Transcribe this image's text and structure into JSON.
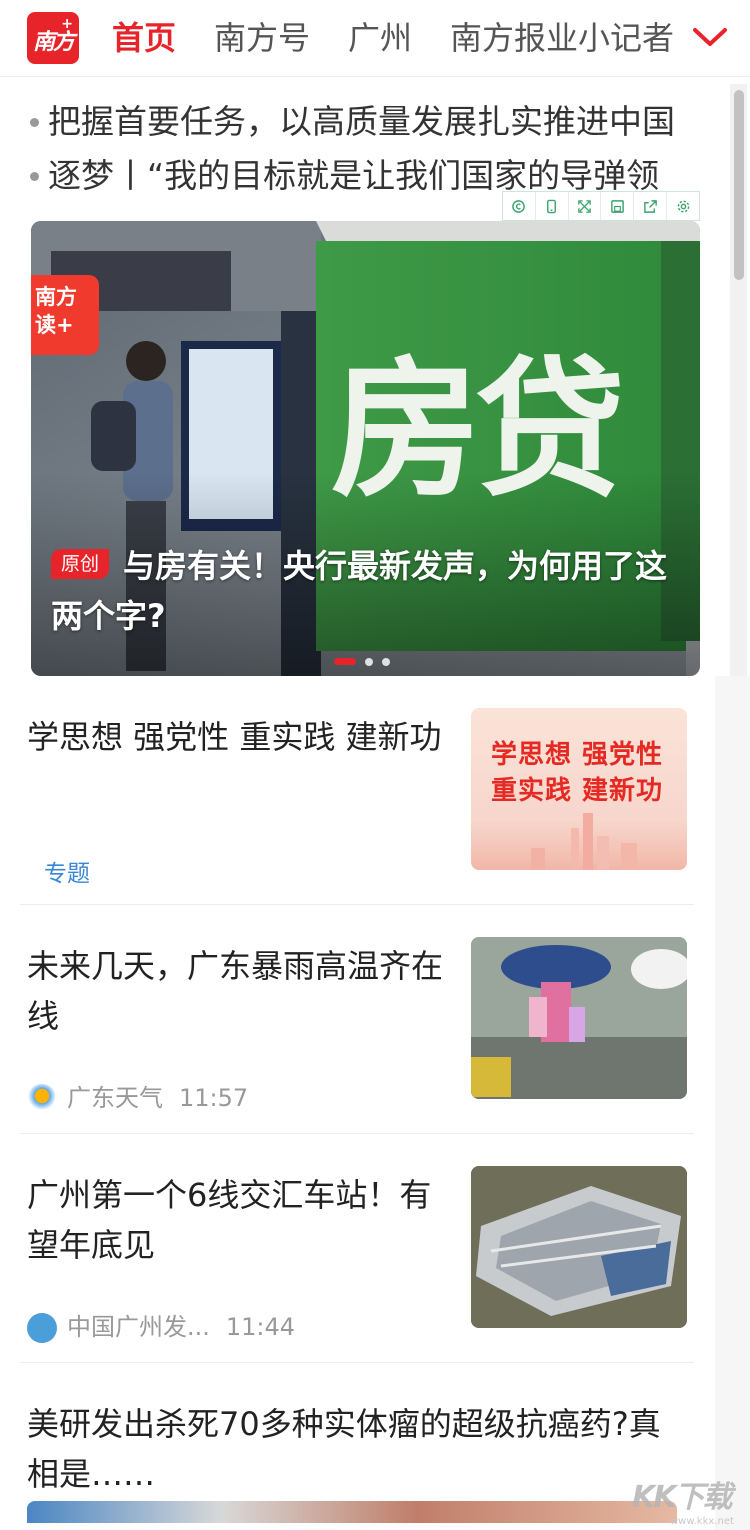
{
  "nav": {
    "logo_text": "南方",
    "logo_plus": "+",
    "tabs": [
      {
        "label": "首页",
        "active": true
      },
      {
        "label": "南方号",
        "active": false
      },
      {
        "label": "广州",
        "active": false
      },
      {
        "label": "南方报业小记者",
        "active": false
      }
    ],
    "expand_icon": "chevron-down-icon"
  },
  "ticker": [
    "把握首要任务，以高质量发展扎实推进中国",
    "逐梦丨“我的目标就是让我们国家的导弹领"
  ],
  "toolbar": {
    "icons": [
      "copyright-icon",
      "phone-icon",
      "fullscreen-icon",
      "save-icon",
      "share-icon",
      "settings-icon"
    ]
  },
  "carousel": {
    "source_badge": "南方\n读+",
    "banner_text": "房贷",
    "tag": "原创",
    "caption": "与房有关！央行最新发声，为何用了这两个字?",
    "slide_count": 3,
    "active_index": 0
  },
  "feed": [
    {
      "title": "学思想 强党性 重实践 建新功",
      "tag": "专题",
      "thumb_text_line1": "学思想 强党性",
      "thumb_text_line2": "重实践 建新功"
    },
    {
      "title": "未来几天，广东暴雨高温齐在线",
      "source": "广东天气",
      "time": "11:57"
    },
    {
      "title": "广州第一个6线交汇车站！有望年底见",
      "source": "中国广州发...",
      "time": "11:44"
    },
    {
      "title": "美研发出杀死70多种实体瘤的超级抗癌药?真相是……"
    }
  ],
  "watermark": "KK下载",
  "watermark_small": "www.kkx.net",
  "colors": {
    "brand_red": "#e8242b",
    "link_blue": "#3a86d6",
    "meta_gray": "#999999",
    "banner_green": "#3f9a47"
  }
}
